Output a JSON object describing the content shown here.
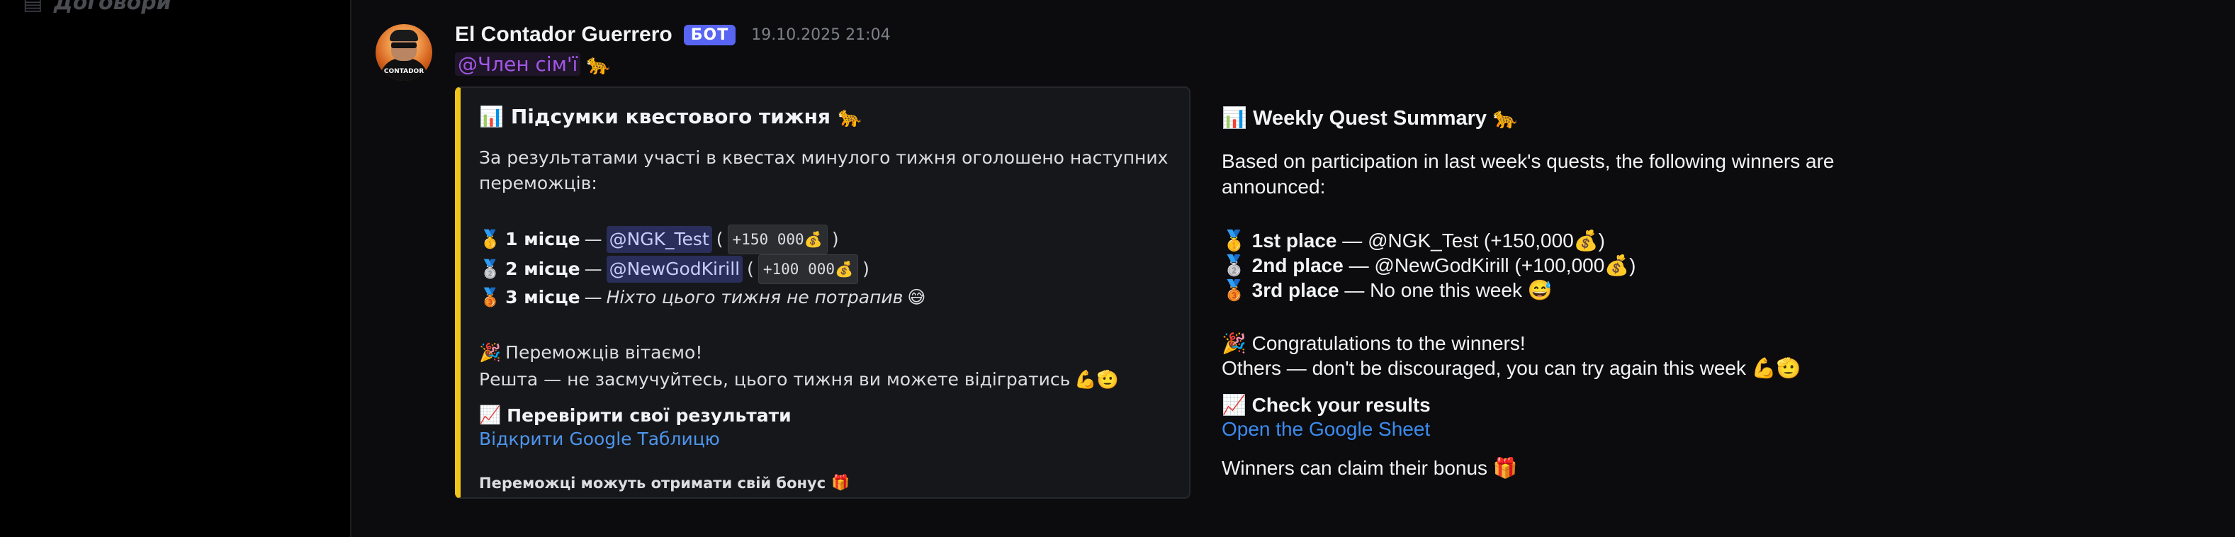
{
  "sidebar": {
    "channel_label": "Договори",
    "channel_icon": "file-icon"
  },
  "message": {
    "username": "El Contador Guerrero",
    "bot_badge": "БОТ",
    "timestamp": "19.10.2025 21:04",
    "avatar_text": "CONTADOR",
    "role_mention": "@Член сім'ї",
    "role_emoji": "🐆",
    "embed": {
      "accent_color": "#f0c419",
      "title_emoji": "📊",
      "title": "Підсумки квестового тижня",
      "title_emoji_end": "🐆",
      "description": "За результатами участі в квестах минулого тижня оголошено наступних переможців:",
      "places": [
        {
          "medal": "🥇",
          "label": "1 місце",
          "sep": "—",
          "user": "@NGK_Test",
          "prize": "+150 000💰"
        },
        {
          "medal": "🥈",
          "label": "2 місце",
          "sep": "—",
          "user": "@NewGodKirill",
          "prize": "+100 000💰"
        },
        {
          "medal": "🥉",
          "label": "3 місце",
          "sep": "—",
          "note": "Ніхто цього тижня не потрапив",
          "note_emoji": "😅"
        }
      ],
      "congrats_emoji": "🎉",
      "congrats": "Переможців вітаємо!",
      "others": "Решта — не засмучуйтесь, цього тижня ви можете відігратись",
      "others_emoji": "💪🫡",
      "field_emoji": "📈",
      "field_title": "Перевірити свої результати",
      "field_link": "Відкрити Google Таблицю",
      "footer": "Переможці можуть отримати свій бонус",
      "footer_emoji": "🎁"
    }
  },
  "translation": {
    "title_emoji": "📊",
    "title": "Weekly Quest Summary",
    "title_emoji_end": "🐆",
    "description": "Based on participation in last week's quests, the following winners are announced:",
    "places": [
      {
        "medal": "🥇",
        "label": "1st place",
        "rest": "— @NGK_Test (+150,000💰)"
      },
      {
        "medal": "🥈",
        "label": "2nd place",
        "rest": "— @NewGodKirill (+100,000💰)"
      },
      {
        "medal": "🥉",
        "label": "3rd place",
        "rest": "— No one this week 😅"
      }
    ],
    "congrats": "🎉 Congratulations to the winners!",
    "others": "Others — don't be discouraged, you can try again this week 💪🫡",
    "field_emoji": "📈",
    "field_title": "Check your results",
    "field_link": "Open the Google Sheet",
    "footer": "Winners can claim their bonus 🎁"
  }
}
